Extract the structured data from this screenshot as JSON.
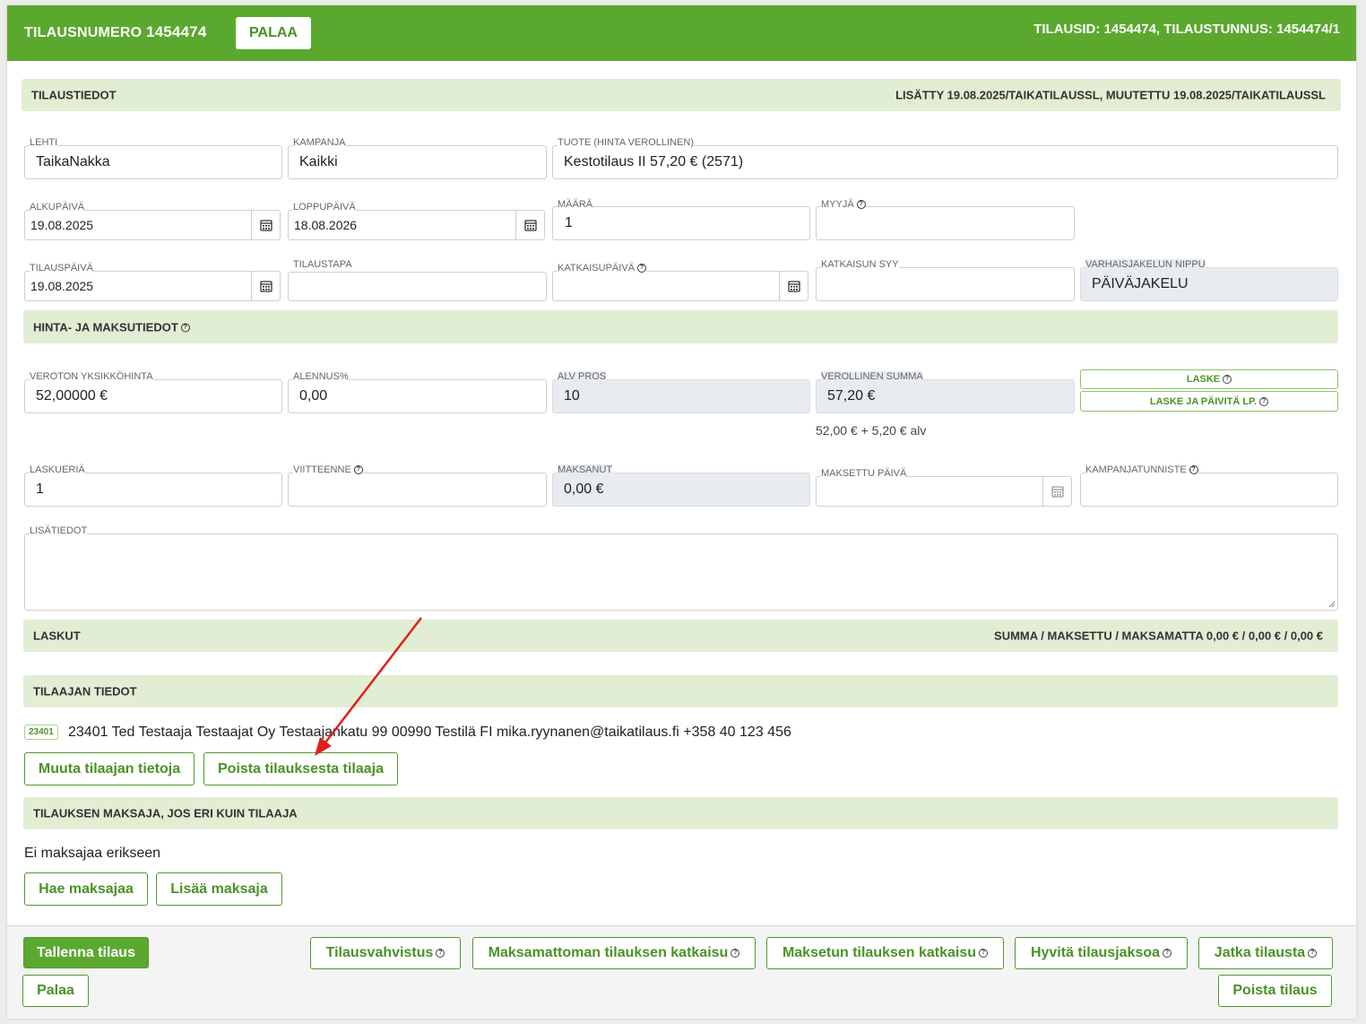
{
  "header": {
    "order_label": "TILAUSNUMERO",
    "order_number": "1454474",
    "back_button": "PALAA",
    "ids_text": "TILAUSID: 1454474, TILAUSTUNNUS: 1454474/1"
  },
  "tilaustiedot": {
    "title": "TILAUSTIEDOT",
    "meta": "LISÄTTY 19.08.2025/TAIKATILAUSSL, MUUTETTU 19.08.2025/TAIKATILAUSSL"
  },
  "fields": {
    "lehti": {
      "label": "LEHTI",
      "value": "TaikaNakka"
    },
    "kampanja": {
      "label": "KAMPANJA",
      "value": "Kaikki"
    },
    "tuote": {
      "label": "TUOTE (HINTA VEROLLINEN)",
      "value": "Kestotilaus II 57,20 € (2571)"
    },
    "alkupaiva": {
      "label": "ALKUPÄIVÄ",
      "value": "19.08.2025"
    },
    "loppupaiva": {
      "label": "LOPPUPÄIVÄ",
      "value": "18.08.2026"
    },
    "maara": {
      "label": "MÄÄRÄ",
      "value": "1"
    },
    "myyja": {
      "label": "MYYJÄ",
      "value": ""
    },
    "tilauspaiva": {
      "label": "TILAUSPÄIVÄ",
      "value": "19.08.2025"
    },
    "tilaustapa": {
      "label": "TILAUSTAPA",
      "value": ""
    },
    "katkaisupaiva": {
      "label": "KATKAISUPÄIVÄ",
      "value": ""
    },
    "katkaisun_syy": {
      "label": "KATKAISUN SYY",
      "value": ""
    },
    "varhaisjakelun_nippu": {
      "label": "VARHAISJAKELUN NIPPU",
      "value": "PÄIVÄJAKELU"
    }
  },
  "hinta": {
    "title": "HINTA- JA MAKSUTIEDOT",
    "veroton": {
      "label": "VEROTON YKSIKKÖHINTA",
      "value": "52,00000 €"
    },
    "alennus": {
      "label": "ALENNUS%",
      "value": "0,00"
    },
    "alv": {
      "label": "ALV PROS",
      "value": "10"
    },
    "verollinen": {
      "label": "VEROLLINEN SUMMA",
      "value": "57,20 €"
    },
    "breakdown": "52,00 € + 5,20 € alv",
    "laske_button": "LASKE",
    "laske_paivita_button": "LASKE JA PÄIVITÄ LP.",
    "laskueria": {
      "label": "LASKUERIÄ",
      "value": "1"
    },
    "viitteenne": {
      "label": "VIITTEENNE",
      "value": ""
    },
    "maksanut": {
      "label": "MAKSANUT",
      "value": "0,00 €"
    },
    "maksettu_paiva": {
      "label": "MAKSETTU PÄIVÄ",
      "value": ""
    },
    "kampanjatunniste": {
      "label": "KAMPANJATUNNISTE",
      "value": ""
    },
    "lisatiedot": {
      "label": "LISÄTIEDOT",
      "value": ""
    }
  },
  "laskut": {
    "title": "LASKUT",
    "summary": "SUMMA / MAKSETTU / MAKSAMATTA 0,00 € / 0,00 € / 0,00 €"
  },
  "tilaaja": {
    "title": "TILAAJAN TIEDOT",
    "badge": "23401",
    "info": "23401 Ted Testaaja Testaajat Oy Testaajankatu 99 00990 Testilä FI mika.ryynanen@taikatilaus.fi +358 40 123 456",
    "edit_button": "Muuta tilaajan tietoja",
    "remove_button": "Poista tilauksesta tilaaja"
  },
  "maksaja": {
    "title": "TILAUKSEN MAKSAJA, JOS ERI KUIN TILAAJA",
    "none_text": "Ei maksajaa erikseen",
    "find_button": "Hae maksajaa",
    "add_button": "Lisää maksaja"
  },
  "footer": {
    "save": "Tallenna tilaus",
    "back": "Palaa",
    "confirmation": "Tilausvahvistus",
    "cancel_unpaid": "Maksamattoman tilauksen katkaisu",
    "cancel_paid": "Maksetun tilauksen katkaisu",
    "credit": "Hyvitä tilausjaksoa",
    "continue": "Jatka tilausta",
    "delete": "Poista tilaus"
  },
  "colors": {
    "brand_green": "#5ba82f",
    "section_bg": "#e1eed4",
    "annotation_arrow": "#e0201c"
  }
}
